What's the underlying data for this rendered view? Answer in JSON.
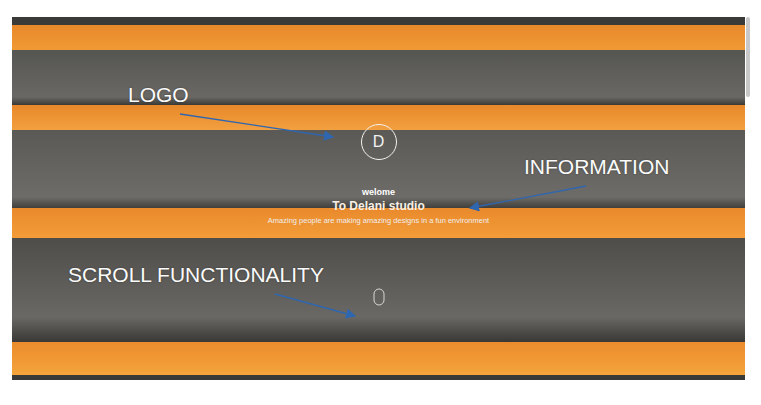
{
  "annotations": [
    {
      "label": "LOGO"
    },
    {
      "label": "INFORMATION"
    },
    {
      "label": "SCROLL FUNCTIONALITY"
    }
  ],
  "hero": {
    "logo": "D",
    "greeting": "welome",
    "title": "To Delani studio",
    "tagline": "Amazing people are making amazing designs in a fun environment"
  }
}
